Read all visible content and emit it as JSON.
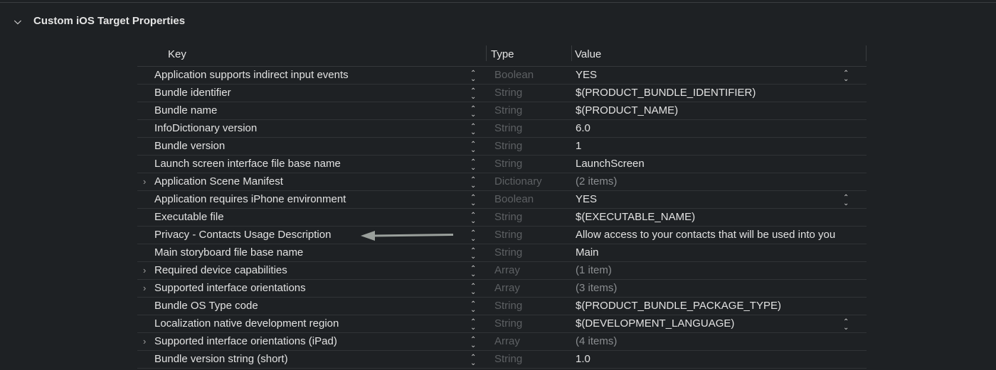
{
  "section": {
    "title": "Custom iOS Target Properties",
    "expanded": true
  },
  "columns": {
    "key": "Key",
    "type": "Type",
    "value": "Value"
  },
  "rows": [
    {
      "key": "Application supports indirect input events",
      "type": "Boolean",
      "value": "YES",
      "expandable": false,
      "popup": true
    },
    {
      "key": "Bundle identifier",
      "type": "String",
      "value": "$(PRODUCT_BUNDLE_IDENTIFIER)",
      "expandable": false,
      "popup": false
    },
    {
      "key": "Bundle name",
      "type": "String",
      "value": "$(PRODUCT_NAME)",
      "expandable": false,
      "popup": false
    },
    {
      "key": "InfoDictionary version",
      "type": "String",
      "value": "6.0",
      "expandable": false,
      "popup": false
    },
    {
      "key": "Bundle version",
      "type": "String",
      "value": "1",
      "expandable": false,
      "popup": false
    },
    {
      "key": "Launch screen interface file base name",
      "type": "String",
      "value": "LaunchScreen",
      "expandable": false,
      "popup": false
    },
    {
      "key": "Application Scene Manifest",
      "type": "Dictionary",
      "value": "(2 items)",
      "expandable": true,
      "popup": false
    },
    {
      "key": "Application requires iPhone environment",
      "type": "Boolean",
      "value": "YES",
      "expandable": false,
      "popup": true
    },
    {
      "key": "Executable file",
      "type": "String",
      "value": "$(EXECUTABLE_NAME)",
      "expandable": false,
      "popup": false
    },
    {
      "key": "Privacy - Contacts Usage Description",
      "type": "String",
      "value": "Allow access to your contacts that will be used into you",
      "expandable": false,
      "popup": false
    },
    {
      "key": "Main storyboard file base name",
      "type": "String",
      "value": "Main",
      "expandable": false,
      "popup": false
    },
    {
      "key": "Required device capabilities",
      "type": "Array",
      "value": "(1 item)",
      "expandable": true,
      "popup": false
    },
    {
      "key": "Supported interface orientations",
      "type": "Array",
      "value": "(3 items)",
      "expandable": true,
      "popup": false
    },
    {
      "key": "Bundle OS Type code",
      "type": "String",
      "value": "$(PRODUCT_BUNDLE_PACKAGE_TYPE)",
      "expandable": false,
      "popup": false
    },
    {
      "key": "Localization native development region",
      "type": "String",
      "value": "$(DEVELOPMENT_LANGUAGE)",
      "expandable": false,
      "popup": true
    },
    {
      "key": "Supported interface orientations (iPad)",
      "type": "Array",
      "value": "(4 items)",
      "expandable": true,
      "popup": false
    },
    {
      "key": "Bundle version string (short)",
      "type": "String",
      "value": "1.0",
      "expandable": false,
      "popup": false
    }
  ],
  "colors": {
    "background": "#1e2124",
    "annotation_arrow": "#9aa09c"
  }
}
